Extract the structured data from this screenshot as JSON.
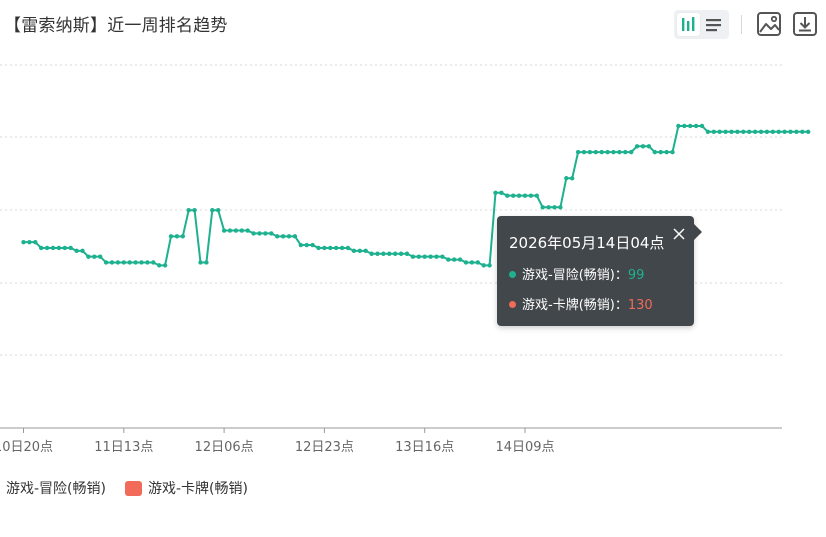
{
  "title": "【雷索纳斯】近一周排名趋势",
  "toolbar": {
    "icons": [
      "bar-chart-icon",
      "list-icon",
      "image-icon",
      "download-icon"
    ],
    "active_color": "#1eb18f",
    "icon_color": "#555555"
  },
  "tooltip": {
    "title": "2026年05月14日04点",
    "rows": [
      {
        "label": "游戏-冒险(畅销)：",
        "value": "99",
        "color": "#1eb18f"
      },
      {
        "label": "游戏-卡牌(畅销)：",
        "value": "130",
        "color": "#f26a5a"
      }
    ]
  },
  "chart_data": {
    "type": "line",
    "x_tick_labels": [
      "10日20点",
      "11日13点",
      "12日06点",
      "12日23点",
      "13日16点",
      "14日09点"
    ],
    "x_tick_index": [
      0,
      17,
      34,
      51,
      68,
      85
    ],
    "y_reversed": true,
    "ylim": [
      50,
      300
    ],
    "grid": true,
    "legend_position": "bottom-left",
    "series": [
      {
        "name": "游戏-冒险(畅销)",
        "color": "#1eb18f",
        "values": [
          172,
          172,
          172,
          176,
          176,
          176,
          176,
          176,
          176,
          178,
          178,
          182,
          182,
          182,
          186,
          186,
          186,
          186,
          186,
          186,
          186,
          186,
          186,
          188,
          188,
          168,
          168,
          168,
          150,
          150,
          186,
          186,
          150,
          150,
          164,
          164,
          164,
          164,
          164,
          166,
          166,
          166,
          166,
          168,
          168,
          168,
          168,
          174,
          174,
          174,
          176,
          176,
          176,
          176,
          176,
          176,
          178,
          178,
          178,
          180,
          180,
          180,
          180,
          180,
          180,
          180,
          182,
          182,
          182,
          182,
          182,
          182,
          184,
          184,
          184,
          186,
          186,
          186,
          188,
          188,
          138,
          138,
          140,
          140,
          140,
          140,
          140,
          140,
          148,
          148,
          148,
          148,
          128,
          128,
          110,
          110,
          110,
          110,
          110,
          110,
          110,
          110,
          110,
          110,
          106,
          106,
          106,
          110,
          110,
          110,
          110,
          92,
          92,
          92,
          92,
          92,
          96,
          96,
          96,
          96,
          96,
          96,
          96,
          96,
          96,
          96,
          96,
          96,
          96,
          96,
          96,
          96,
          96,
          96
        ]
      },
      {
        "name": "游戏-卡牌(畅销)",
        "color": "#f26a5a",
        "values": [
          null,
          null,
          null,
          null,
          null,
          null,
          null,
          null,
          null,
          null,
          null,
          null,
          null,
          null,
          null,
          null,
          null,
          null,
          null,
          null,
          null,
          null,
          null,
          null,
          null,
          null,
          null,
          null,
          null,
          null,
          null,
          null,
          null,
          null,
          null,
          null,
          null,
          null,
          null,
          null,
          null,
          null,
          null,
          null,
          null,
          null,
          null,
          null,
          null,
          null,
          null,
          null,
          null,
          null,
          null,
          null,
          null,
          null,
          null,
          null,
          null,
          null,
          null,
          null,
          null,
          null,
          null,
          null,
          null,
          null,
          null,
          null,
          null,
          null,
          null,
          null,
          null,
          null,
          null,
          null,
          null,
          null,
          null,
          null,
          null,
          null,
          null,
          null,
          null,
          null,
          null,
          null,
          null,
          null,
          null,
          null,
          null,
          null,
          null,
          null,
          null,
          null,
          null,
          null,
          null,
          null,
          null,
          null,
          null,
          null,
          null,
          null,
          null,
          null,
          null,
          null,
          null,
          null,
          null,
          null,
          null,
          null,
          null,
          null,
          null,
          null,
          null,
          null,
          null,
          null,
          null,
          null,
          null,
          null
        ]
      }
    ]
  }
}
